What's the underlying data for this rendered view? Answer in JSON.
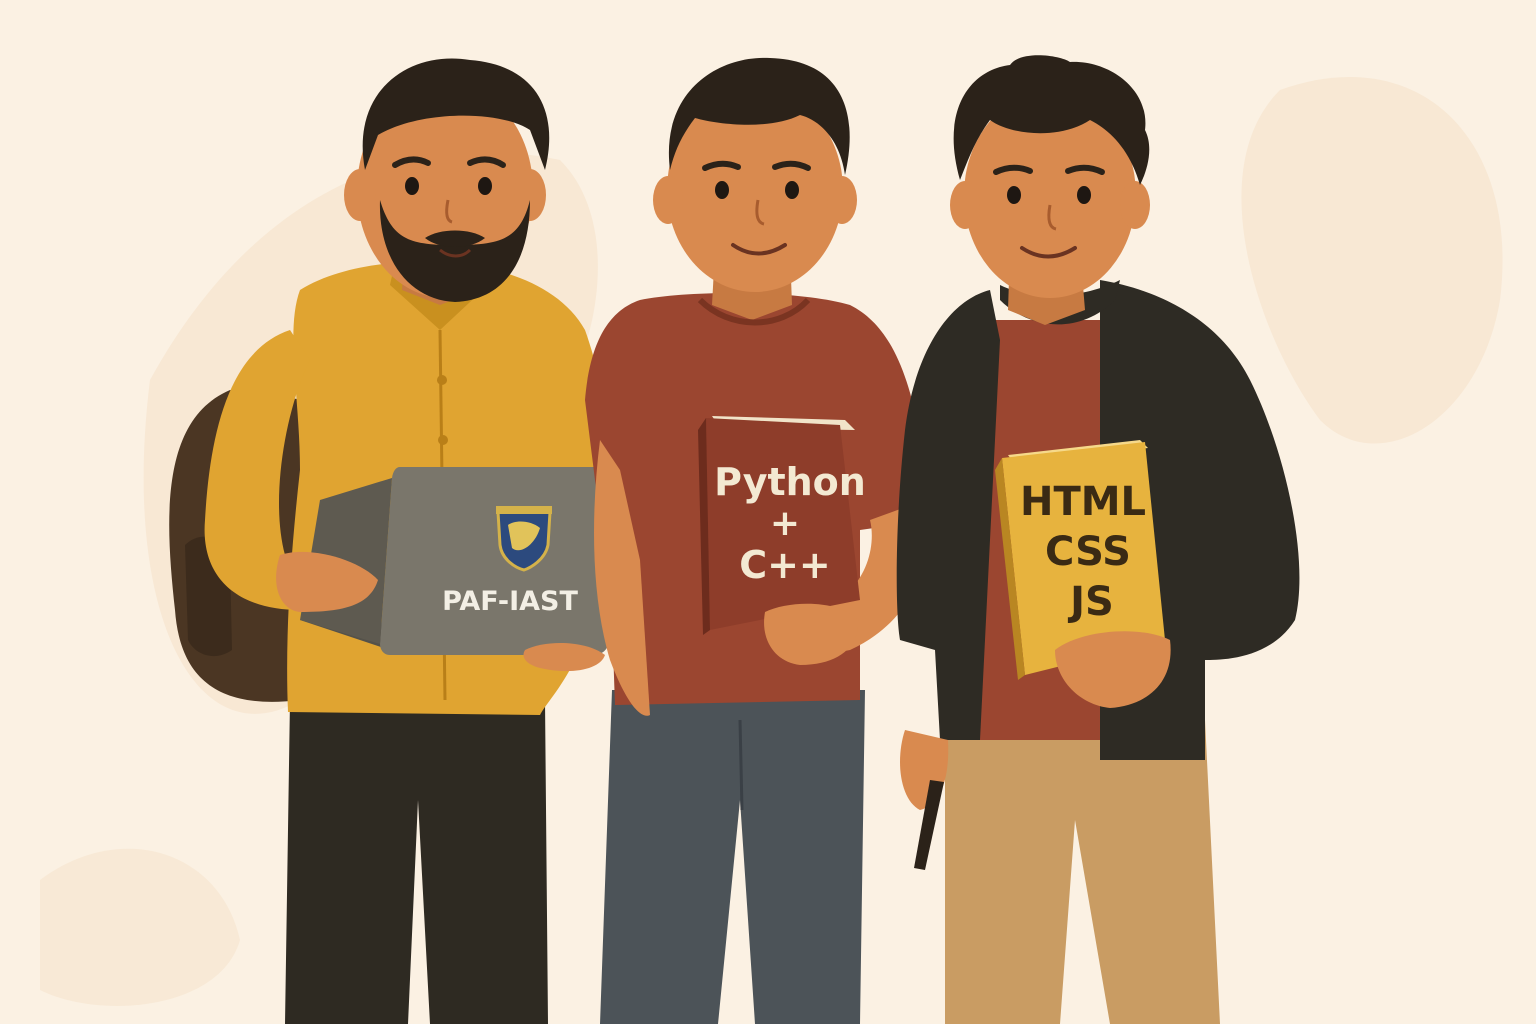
{
  "laptop": {
    "brand_text": "PAF-IAST",
    "logo_icon": "university-crest-icon"
  },
  "book_python": {
    "line1": "Python",
    "line2": "+",
    "line3": "C++"
  },
  "book_web": {
    "line1": "HTML",
    "line2": "CSS",
    "line3": "JS"
  },
  "colors": {
    "background": "#fbf1e3",
    "skin": "#d98a4f",
    "hair": "#2b2219",
    "yellow_shirt": "#e0a431",
    "rust_tshirt": "#9b4630",
    "dark_hoodie": "#2e2b24",
    "laptop_gray": "#7a766b",
    "python_book": "#8e3d2a",
    "web_book": "#e7b33e"
  }
}
